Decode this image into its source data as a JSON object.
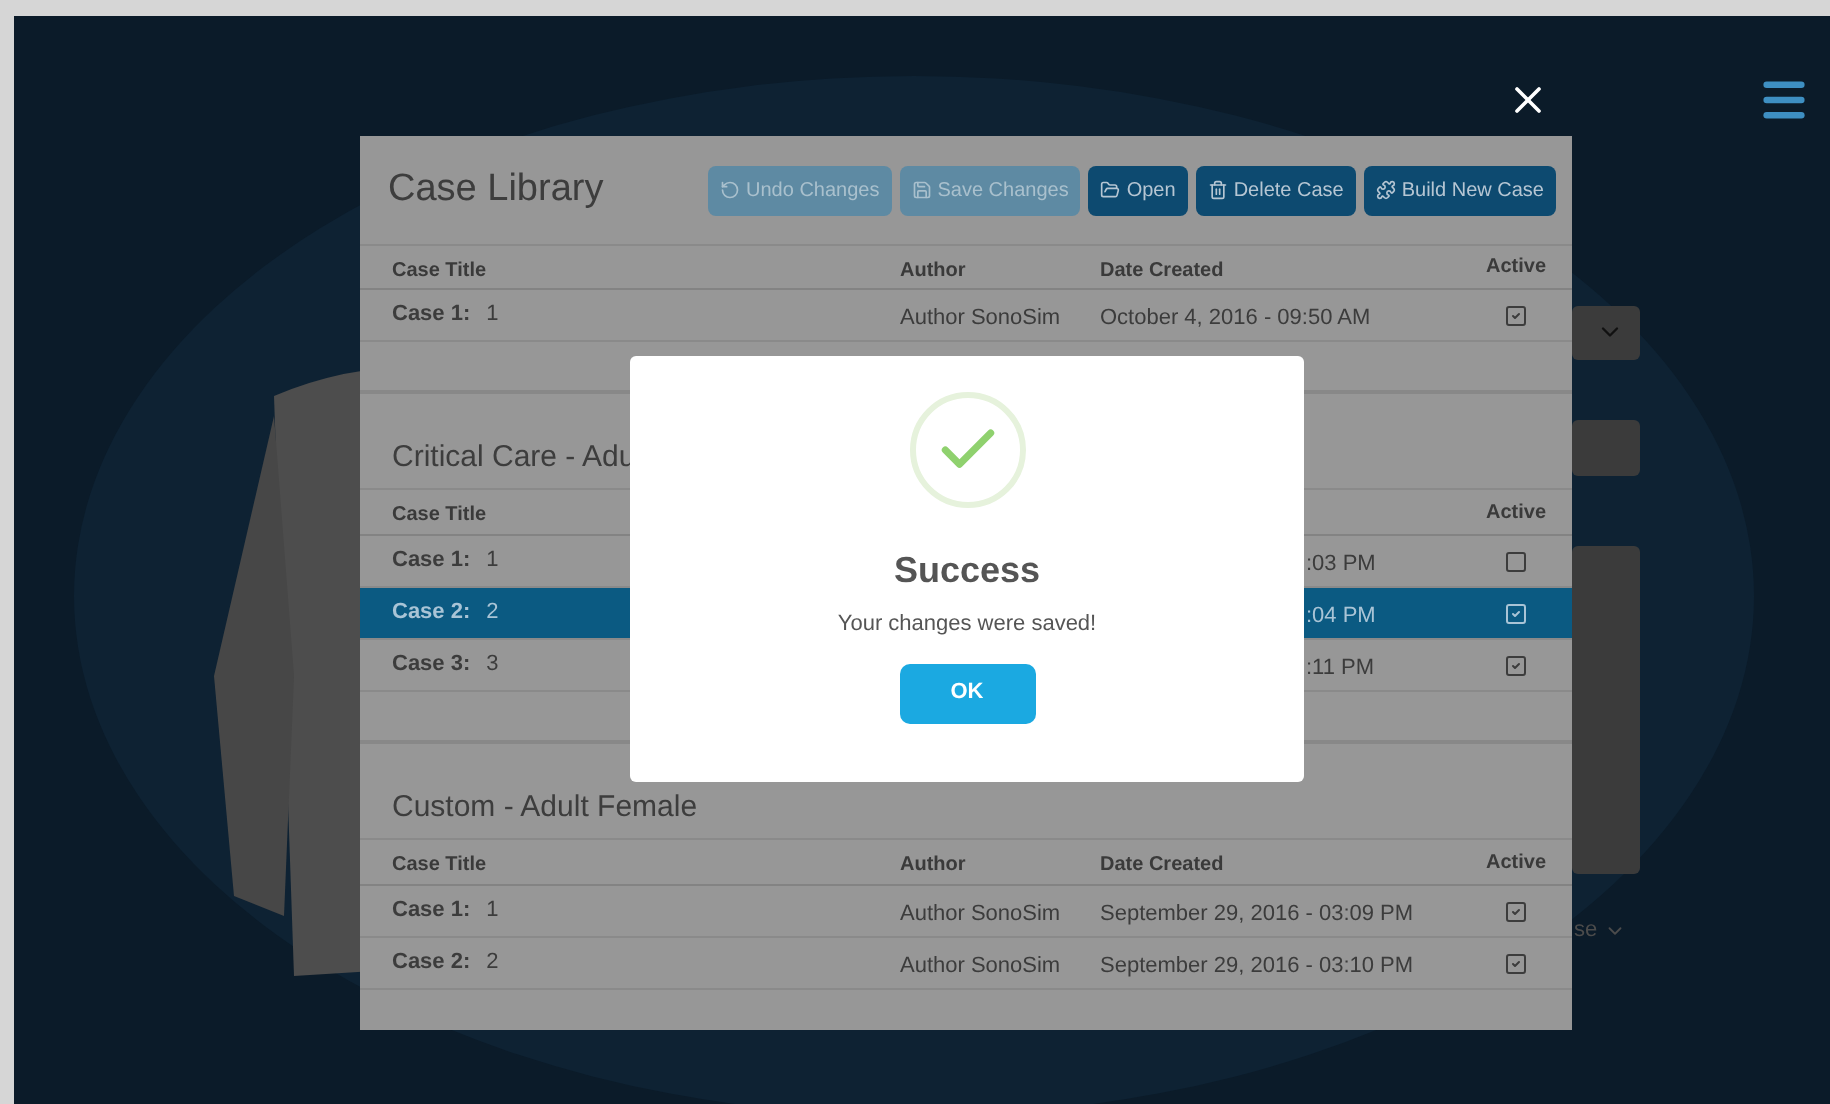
{
  "background_form": {
    "partial_label": "se"
  },
  "case_library": {
    "title": "Case Library",
    "buttons": [
      {
        "label": "Undo Changes",
        "disabled": true
      },
      {
        "label": "Save Changes",
        "disabled": true
      },
      {
        "label": "Open",
        "disabled": false
      },
      {
        "label": "Delete Case",
        "disabled": false
      },
      {
        "label": "Build New Case",
        "disabled": false
      }
    ],
    "groups": [
      {
        "columns": [
          {
            "kind": "title",
            "label": "Case Title"
          },
          {
            "kind": "author",
            "label": "Author"
          },
          {
            "kind": "date",
            "label": "Date Created"
          },
          {
            "kind": "active",
            "label": "Active"
          }
        ],
        "rows": [
          {
            "label": "Case 1:",
            "number": "1",
            "author": "Author SonoSim",
            "date": "October 4, 2016 - 09:50 AM",
            "active": true,
            "selected": false
          }
        ]
      },
      {
        "title": "Critical Care - Adu",
        "columns": [
          {
            "kind": "title",
            "label": "Case Title"
          },
          {
            "kind": "active",
            "label": "Active"
          }
        ],
        "rows": [
          {
            "label": "Case 1:",
            "number": "1",
            "date": ":03 PM",
            "active": false,
            "selected": false
          },
          {
            "label": "Case 2:",
            "number": "2",
            "date": ":04 PM",
            "active": true,
            "selected": true
          },
          {
            "label": "Case 3:",
            "number": "3",
            "date": ":11 PM",
            "active": true,
            "selected": false
          }
        ]
      },
      {
        "title": "Custom - Adult Female",
        "columns": [
          {
            "kind": "title",
            "label": "Case Title"
          },
          {
            "kind": "author",
            "label": "Author"
          },
          {
            "kind": "date",
            "label": "Date Created"
          },
          {
            "kind": "active",
            "label": "Active"
          }
        ],
        "rows": [
          {
            "label": "Case 1:",
            "number": "1",
            "author": "Author SonoSim",
            "date": "September 29, 2016 - 03:09 PM",
            "active": true,
            "selected": false
          },
          {
            "label": "Case 2:",
            "number": "2",
            "author": "Author SonoSim",
            "date": "September 29, 2016 - 03:10 PM",
            "active": true,
            "selected": false
          }
        ]
      }
    ]
  },
  "dialog": {
    "title": "Success",
    "message": "Your changes were saved!",
    "button": "OK"
  }
}
